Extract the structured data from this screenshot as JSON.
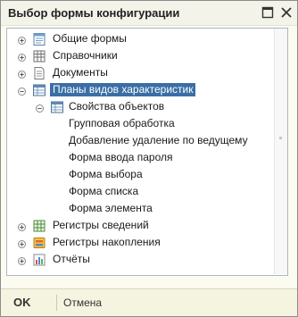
{
  "window": {
    "title": "Выбор формы конфигурации"
  },
  "tree": {
    "items": [
      {
        "label": "Общие формы",
        "expander": "plus",
        "icon": "form-icon"
      },
      {
        "label": "Справочники",
        "expander": "plus",
        "icon": "catalog-icon"
      },
      {
        "label": "Документы",
        "expander": "plus",
        "icon": "document-icon"
      },
      {
        "label": "Планы видов характеристик",
        "expander": "minus",
        "icon": "chart-of-characteristics-icon",
        "selected": true
      },
      {
        "label": "Свойства объектов",
        "expander": "minus",
        "icon": "chart-of-characteristics-icon"
      },
      {
        "label": "Групповая обработка"
      },
      {
        "label": "Добавление удаление по ведущему"
      },
      {
        "label": "Форма ввода пароля"
      },
      {
        "label": "Форма выбора"
      },
      {
        "label": "Форма списка"
      },
      {
        "label": "Форма элемента"
      },
      {
        "label": "Регистры сведений",
        "expander": "plus",
        "icon": "information-register-icon"
      },
      {
        "label": "Регистры накопления",
        "expander": "plus",
        "icon": "accumulation-register-icon"
      },
      {
        "label": "Отчёты",
        "expander": "plus",
        "icon": "report-icon"
      }
    ]
  },
  "footer": {
    "ok_label": "OK",
    "cancel_label": "Отмена"
  },
  "colors": {
    "selection": "#3a6ea5",
    "window_bg": "#fbfbf1",
    "footer_bg": "#f5f4e0"
  }
}
